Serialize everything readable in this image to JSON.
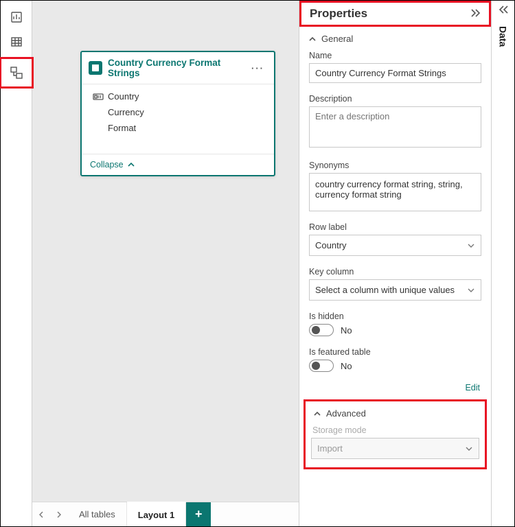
{
  "nav": {
    "active_view": "model"
  },
  "table_card": {
    "title": "Country Currency Format Strings",
    "fields": [
      {
        "label": "Country",
        "icon": "key"
      },
      {
        "label": "Currency",
        "icon": "none"
      },
      {
        "label": "Format",
        "icon": "none"
      }
    ],
    "collapse_label": "Collapse"
  },
  "footer": {
    "tab_all": "All tables",
    "tab_layout": "Layout 1"
  },
  "properties": {
    "title": "Properties",
    "sections": {
      "general": "General",
      "advanced": "Advanced"
    },
    "name": {
      "label": "Name",
      "value": "Country Currency Format Strings"
    },
    "description": {
      "label": "Description",
      "placeholder": "Enter a description",
      "value": ""
    },
    "synonyms": {
      "label": "Synonyms",
      "value": "country currency format string, string, currency format string"
    },
    "row_label": {
      "label": "Row label",
      "value": "Country"
    },
    "key_column": {
      "label": "Key column",
      "value": "Select a column with unique values"
    },
    "is_hidden": {
      "label": "Is hidden",
      "state_text": "No"
    },
    "is_featured": {
      "label": "Is featured table",
      "state_text": "No"
    },
    "edit_link": "Edit",
    "storage_mode": {
      "label": "Storage mode",
      "value": "Import"
    }
  },
  "data_pane": {
    "label": "Data"
  }
}
